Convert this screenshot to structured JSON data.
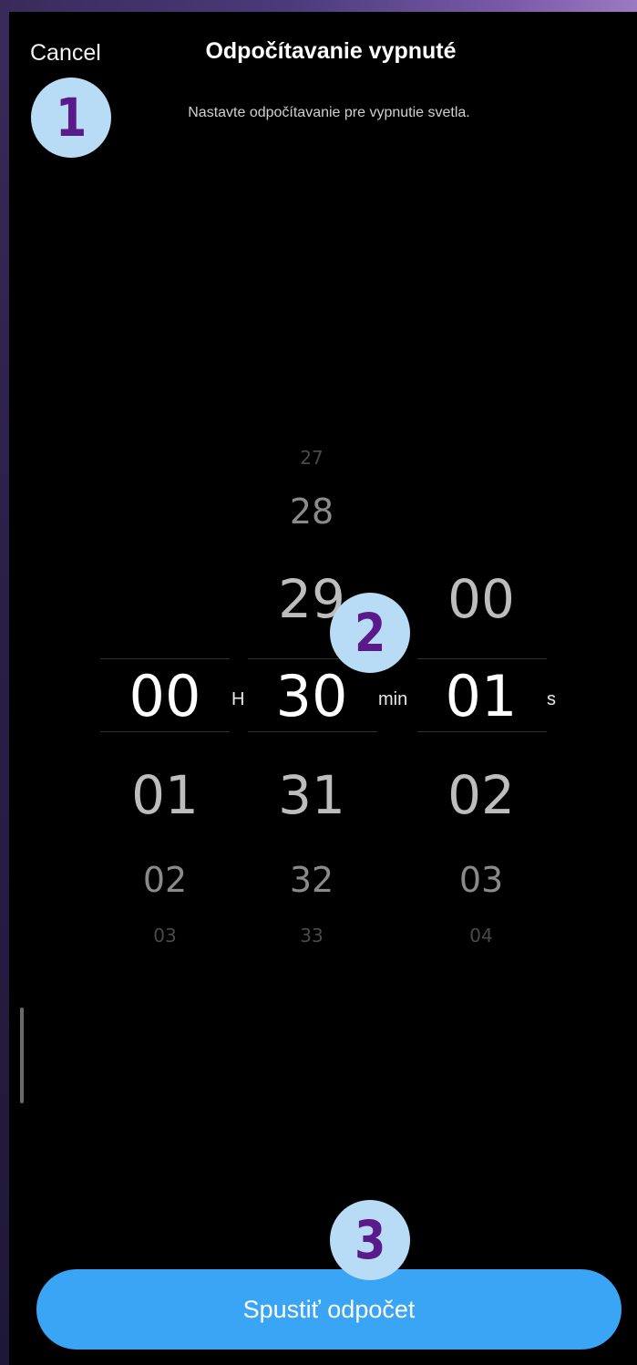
{
  "header": {
    "cancel_label": "Cancel",
    "title": "Odpočítavanie vypnuté",
    "subtitle": "Nastavte odpočítavanie pre vypnutie svetla."
  },
  "picker": {
    "hours": {
      "above": [
        "",
        "",
        ""
      ],
      "selected": "00",
      "below": [
        "01",
        "02",
        "03"
      ],
      "unit": "H"
    },
    "minutes": {
      "above": [
        "27",
        "28",
        "29"
      ],
      "selected": "30",
      "below": [
        "31",
        "32",
        "33"
      ],
      "unit": "min"
    },
    "seconds": {
      "above": [
        "",
        "",
        "00"
      ],
      "selected": "01",
      "below": [
        "02",
        "03",
        "04"
      ],
      "unit": "s"
    }
  },
  "annotations": {
    "badge_1": "1",
    "badge_2": "2",
    "badge_3": "3"
  },
  "actions": {
    "start_label": "Spustiť odpočet"
  },
  "colors": {
    "background": "#000000",
    "button": "#3aa4f5",
    "badge_fill": "#b8dcf5",
    "badge_text": "#5a1a8a"
  }
}
